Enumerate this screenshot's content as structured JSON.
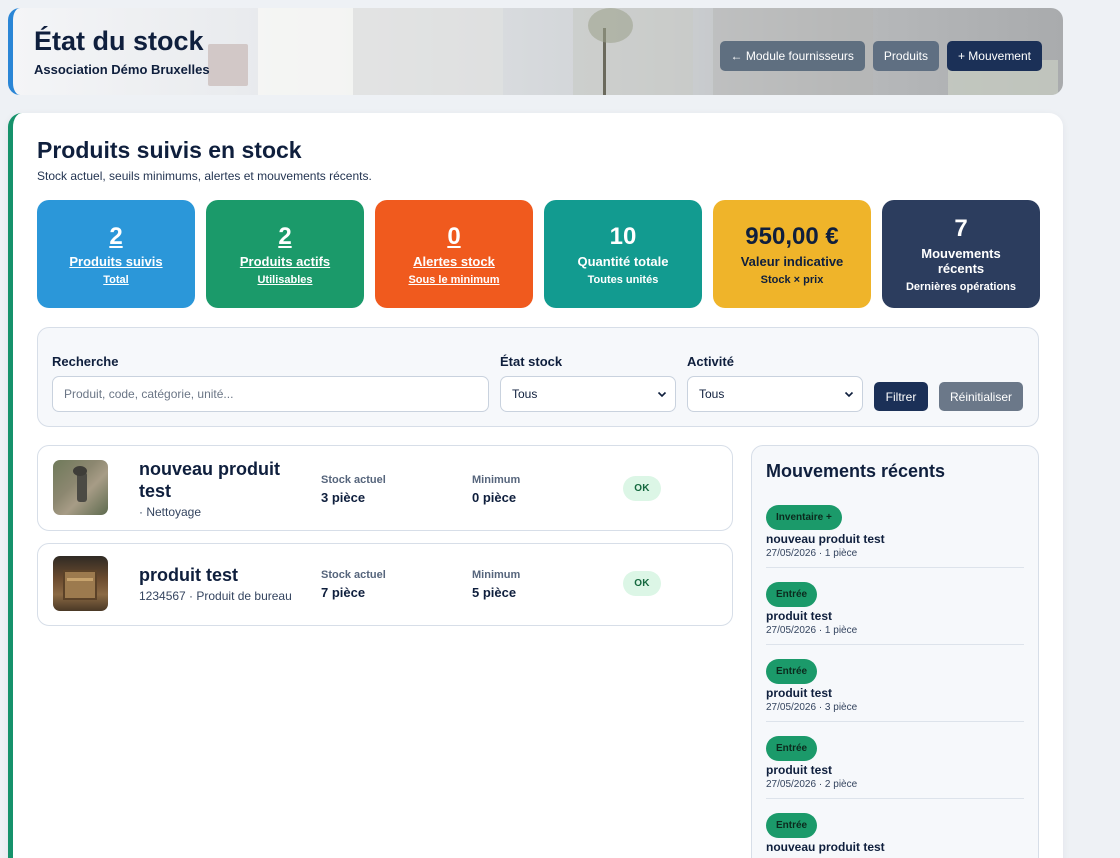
{
  "header": {
    "title": "État du stock",
    "subtitle": "Association Démo Bruxelles",
    "actions": {
      "suppliers": "← Module fournisseurs",
      "products": "Produits",
      "movement": "+ Mouvement"
    }
  },
  "main": {
    "title": "Produits suivis en stock",
    "lead": "Stock actuel, seuils minimums, alertes et mouvements récents."
  },
  "tiles": [
    {
      "value": "2",
      "label": "Produits suivis",
      "sub": "Total"
    },
    {
      "value": "2",
      "label": "Produits actifs",
      "sub": "Utilisables"
    },
    {
      "value": "0",
      "label": "Alertes stock",
      "sub": "Sous le minimum"
    },
    {
      "value": "10",
      "label": "Quantité totale",
      "sub": "Toutes unités"
    },
    {
      "value": "950,00 €",
      "label": "Valeur indicative",
      "sub": "Stock × prix"
    },
    {
      "value": "7",
      "label": "Mouvements récents",
      "sub": "Dernières opérations"
    }
  ],
  "filters": {
    "search_label": "Recherche",
    "search_placeholder": "Produit, code, catégorie, unité...",
    "state_label": "État stock",
    "state_value": "Tous",
    "activity_label": "Activité",
    "activity_value": "Tous",
    "filter_button": "Filtrer",
    "reset_button": "Réinitialiser"
  },
  "products": [
    {
      "name": "nouveau produit test",
      "meta": "· Nettoyage",
      "stock_label": "Stock actuel",
      "stock_value": "3 pièce",
      "min_label": "Minimum",
      "min_value": "0 pièce",
      "status": "OK"
    },
    {
      "name": "produit test",
      "meta": "1234567 · Produit de bureau",
      "stock_label": "Stock actuel",
      "stock_value": "7 pièce",
      "min_label": "Minimum",
      "min_value": "5 pièce",
      "status": "OK"
    }
  ],
  "movements": {
    "title": "Mouvements récents",
    "items": [
      {
        "type": "Inventaire +",
        "product": "nouveau produit test",
        "detail": "27/05/2026 · 1 pièce"
      },
      {
        "type": "Entrée",
        "product": "produit test",
        "detail": "27/05/2026 · 1 pièce"
      },
      {
        "type": "Entrée",
        "product": "produit test",
        "detail": "27/05/2026 · 3 pièce"
      },
      {
        "type": "Entrée",
        "product": "produit test",
        "detail": "27/05/2026 · 2 pièce"
      },
      {
        "type": "Entrée",
        "product": "nouveau produit test",
        "detail": ""
      }
    ]
  },
  "colors": {
    "navy": "#1b3057",
    "accent_blue": "#2b97d9",
    "accent_green": "#1b9a6a",
    "accent_orange": "#f05a1e",
    "accent_teal": "#129b90",
    "accent_yellow": "#efb42a",
    "accent_slate": "#2c3d5e"
  }
}
